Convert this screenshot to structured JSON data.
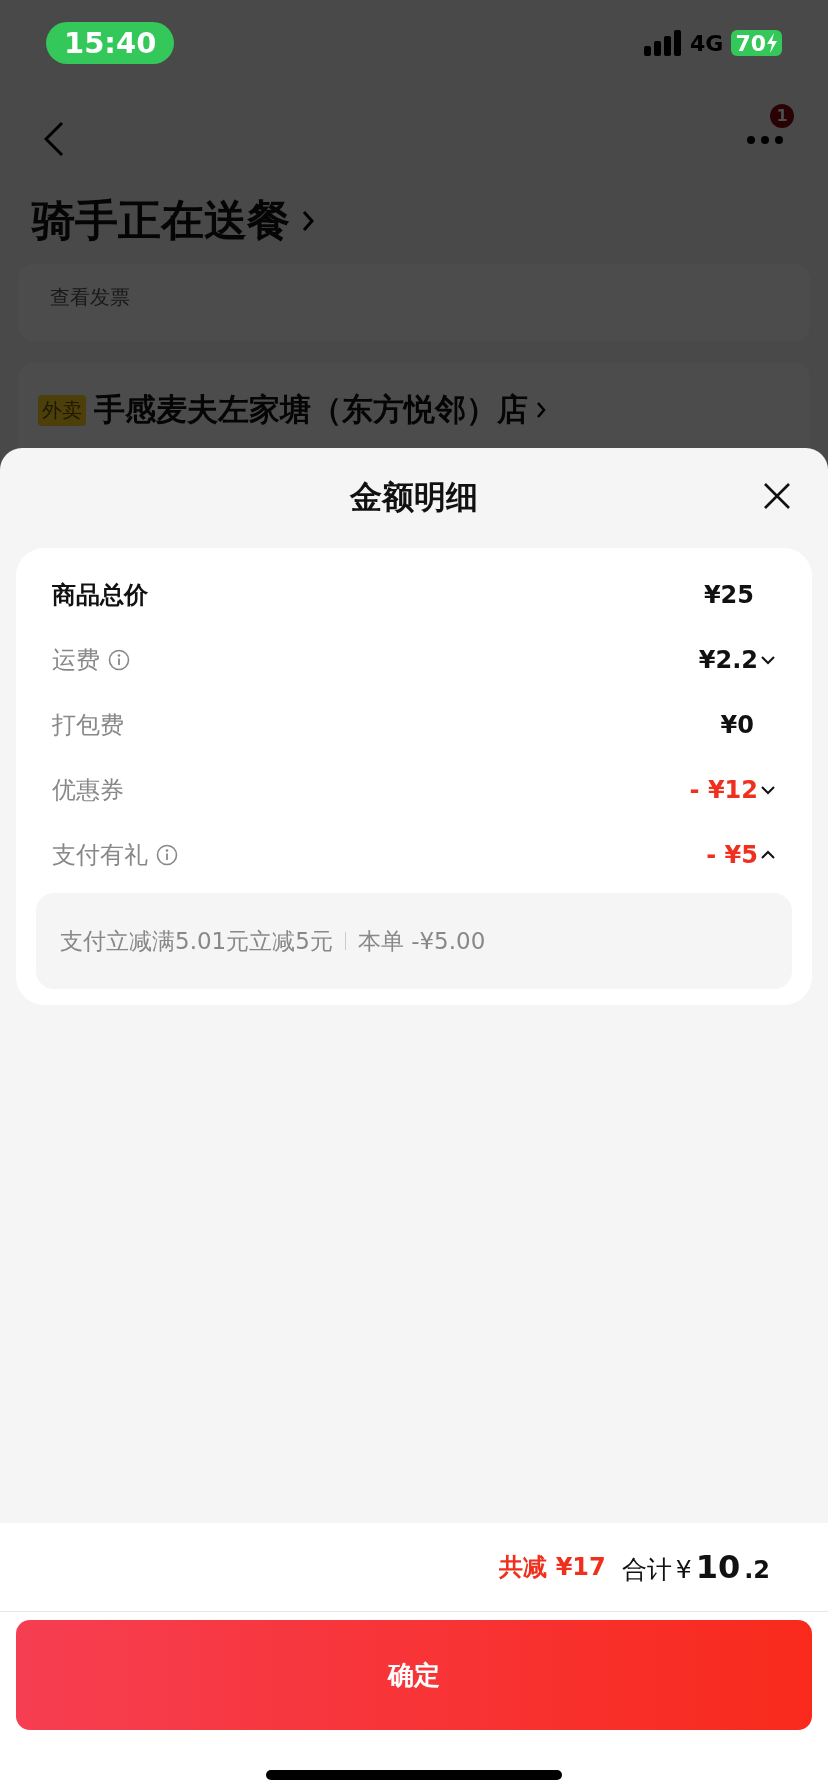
{
  "status_bar": {
    "time": "15:40",
    "network": "4G",
    "battery": "70"
  },
  "nav": {
    "badge": "1"
  },
  "order": {
    "status": "骑手正在送餐",
    "invoice_link": "查看发票",
    "store_tag": "外卖",
    "store_name": "手感麦夫左家塘（东方悦邻）店"
  },
  "sheet": {
    "title": "金额明细",
    "rows": [
      {
        "label": "商品总价",
        "emphasis": true,
        "info": false,
        "value": "¥25",
        "discount": false,
        "kind": "plain"
      },
      {
        "label": "运费",
        "emphasis": false,
        "info": true,
        "value": "¥2.2",
        "discount": false,
        "kind": "expandable",
        "expanded": false
      },
      {
        "label": "打包费",
        "emphasis": false,
        "info": false,
        "value": "¥0",
        "discount": false,
        "kind": "plain"
      },
      {
        "label": "优惠券",
        "emphasis": false,
        "info": false,
        "value": "- ¥12",
        "discount": true,
        "kind": "expandable",
        "expanded": false
      },
      {
        "label": "支付有礼",
        "emphasis": false,
        "info": true,
        "value": "- ¥5",
        "discount": true,
        "kind": "expandable",
        "expanded": true
      }
    ],
    "detail": {
      "description": "支付立减满5.01元立减5元",
      "amount": "本单 -¥5.00"
    },
    "summary": {
      "saved": "共减 ¥17",
      "total_label": "合计",
      "total_currency": "¥",
      "total_integer": "10",
      "total_decimal": ".2"
    },
    "confirm_button": "确定"
  }
}
